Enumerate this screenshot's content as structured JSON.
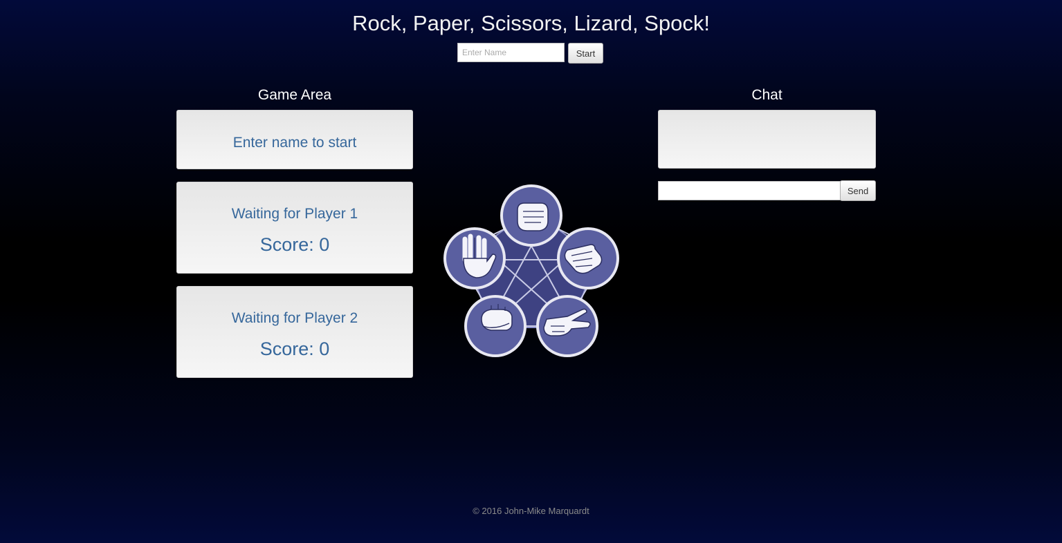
{
  "header": {
    "title": "Rock, Paper, Scissors, Lizard, Spock!",
    "name_placeholder": "Enter Name",
    "start_label": "Start"
  },
  "game": {
    "heading": "Game Area",
    "status": "Enter name to start",
    "players": [
      {
        "name": "Waiting for Player 1",
        "score": "Score: 0"
      },
      {
        "name": "Waiting for Player 2",
        "score": "Score: 0"
      }
    ]
  },
  "diagram": {
    "icons": [
      "rock-hand-icon",
      "paper-hand-icon",
      "scissors-hand-icon",
      "lizard-hand-icon",
      "spock-hand-icon"
    ],
    "colors": {
      "fill": "#5a5fa0",
      "ring": "#e8e8f2",
      "center": "#3e4282"
    }
  },
  "chat": {
    "heading": "Chat",
    "input_value": "",
    "send_label": "Send"
  },
  "footer": {
    "text": "© 2016 John-Mike Marquardt"
  }
}
